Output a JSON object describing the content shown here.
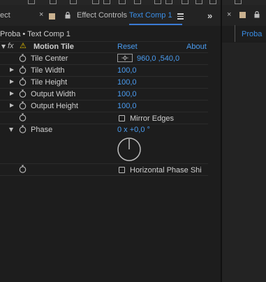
{
  "header": {
    "left_tab_fragment": "ect",
    "tab_prefix": "Effect Controls",
    "tab_comp": "Text Comp 1",
    "breadcrumb": "Proba • Text Comp 1",
    "expand_panels_glyph": "»"
  },
  "right_panel": {
    "tab_label": "Proba"
  },
  "effect": {
    "fx_glyph": "fx",
    "warning_glyph": "⚠",
    "name": "Motion Tile",
    "reset_label": "Reset",
    "about_label": "About"
  },
  "properties": {
    "tile_center": {
      "label": "Tile Center",
      "value": "960,0 ,540,0"
    },
    "tile_width": {
      "label": "Tile Width",
      "value": "100,0"
    },
    "tile_height": {
      "label": "Tile Height",
      "value": "100,0"
    },
    "output_width": {
      "label": "Output Width",
      "value": "100,0"
    },
    "output_height": {
      "label": "Output Height",
      "value": "100,0"
    },
    "mirror_edges": {
      "label": "Mirror Edges",
      "checked": false
    },
    "phase": {
      "label": "Phase",
      "value": "0 x +0,0 °"
    },
    "horizontal_phase_shift": {
      "label": "Horizontal Phase Shi",
      "checked": false
    }
  },
  "colors": {
    "accent": "#3a8ee6",
    "swatch": "#c9b18f",
    "background": "#1d1d1d"
  },
  "icons": [
    "close-icon",
    "color-swatch-icon",
    "lock-icon",
    "panel-menu-icon",
    "expand-panels-icon",
    "fx-icon",
    "warning-icon",
    "stopwatch-icon",
    "disclosure-triangle-icon",
    "point-control-icon",
    "angle-dial-icon",
    "checkbox-icon"
  ]
}
